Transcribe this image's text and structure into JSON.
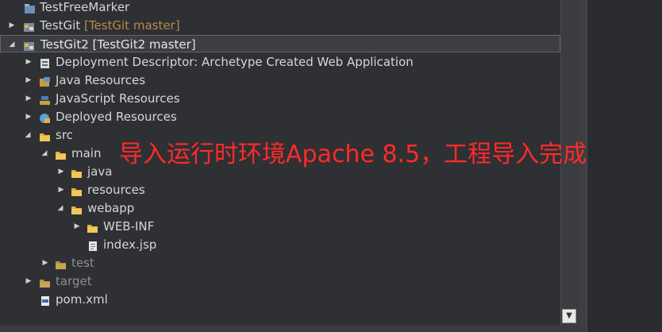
{
  "tree": {
    "rows": [
      {
        "label": "TestFreeMarker",
        "decoration": "",
        "icon": "project-icon"
      },
      {
        "label": "TestGit",
        "decoration": "[TestGit master]",
        "icon": "git-project-icon"
      },
      {
        "label": "TestGit2 [TestGit2 master]",
        "decoration": "",
        "icon": "git-project-icon"
      },
      {
        "label": "Deployment Descriptor: Archetype Created Web Application",
        "icon": "deployment-descriptor-icon"
      },
      {
        "label": "Java Resources",
        "icon": "java-resources-icon"
      },
      {
        "label": "JavaScript Resources",
        "icon": "javascript-resources-icon"
      },
      {
        "label": "Deployed Resources",
        "icon": "deployed-resources-icon"
      },
      {
        "label": "src",
        "icon": "folder-icon"
      },
      {
        "label": "main",
        "icon": "folder-icon"
      },
      {
        "label": "java",
        "icon": "folder-icon"
      },
      {
        "label": "resources",
        "icon": "folder-icon"
      },
      {
        "label": "webapp",
        "icon": "folder-icon"
      },
      {
        "label": "WEB-INF",
        "icon": "folder-icon"
      },
      {
        "label": "index.jsp",
        "icon": "jsp-file-icon"
      },
      {
        "label": "test",
        "icon": "folder-icon"
      },
      {
        "label": "target",
        "icon": "folder-icon"
      },
      {
        "label": "pom.xml",
        "icon": "xml-file-icon"
      }
    ]
  },
  "annotation": {
    "text": "导入运行时环境Apache  8.5，工程导入完成"
  },
  "colors": {
    "background": "#2f3033",
    "text": "#d6d6d6",
    "git_decoration": "#b58b47",
    "annotation": "#ff2a2a",
    "folder": "#e2b23a"
  }
}
